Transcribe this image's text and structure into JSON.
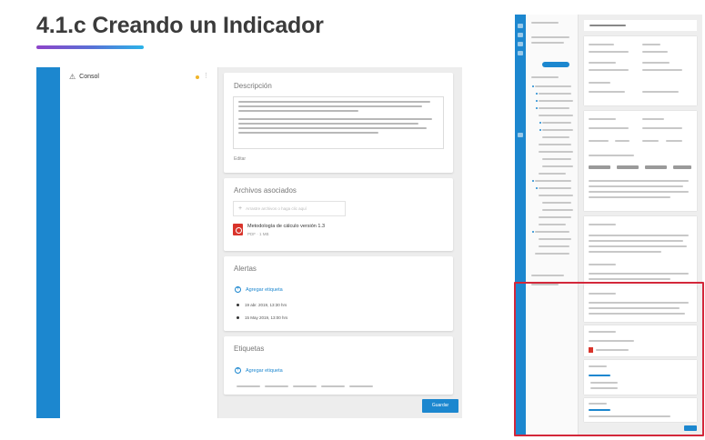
{
  "slide": {
    "title": "4.1.c Creando un Indicador"
  },
  "sidebar": {
    "item_label": "Consol"
  },
  "description_card": {
    "title": "Descripción",
    "link_label": "Editar"
  },
  "files_card": {
    "title": "Archivos asociados",
    "dropzone_placeholder": "Arrastre archivos o haga clic aquí",
    "file_name": "Metodología de cálculo versión 1.3",
    "file_meta": "PDF · 1 MB"
  },
  "alerts_card": {
    "title": "Alertas",
    "add_label": "Agregar etiqueta",
    "alerts": [
      "19 abr. 2019, 13:30 hrs",
      "15 May 2019, 13:00 hrs"
    ]
  },
  "tags_card": {
    "title": "Etiquetas",
    "add_label": "Agregar etiqueta"
  },
  "actions": {
    "save_label": "Guardar"
  },
  "colors": {
    "accent_blue": "#1c87cf",
    "highlight_red": "#d3273a",
    "title_gradient": [
      "#8e44c9",
      "#5a6fd6",
      "#2bb3e8"
    ]
  }
}
